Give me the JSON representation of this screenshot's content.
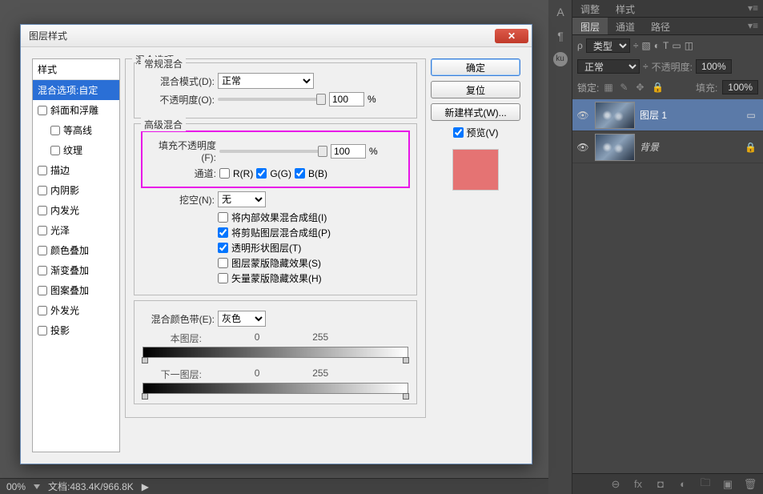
{
  "dialog": {
    "title": "图层样式",
    "styleListHeader": "样式",
    "styles": [
      {
        "label": "混合选项:自定",
        "sel": true,
        "chk": null
      },
      {
        "label": "斜面和浮雕",
        "chk": false
      },
      {
        "label": "等高线",
        "chk": false,
        "indent": true
      },
      {
        "label": "纹理",
        "chk": false,
        "indent": true
      },
      {
        "label": "描边",
        "chk": false
      },
      {
        "label": "内阴影",
        "chk": false
      },
      {
        "label": "内发光",
        "chk": false
      },
      {
        "label": "光泽",
        "chk": false
      },
      {
        "label": "颜色叠加",
        "chk": false
      },
      {
        "label": "渐变叠加",
        "chk": false
      },
      {
        "label": "图案叠加",
        "chk": false
      },
      {
        "label": "外发光",
        "chk": false
      },
      {
        "label": "投影",
        "chk": false
      }
    ],
    "blendOptions": {
      "legend": "混合选项",
      "general": {
        "legend": "常规混合",
        "modeLabel": "混合模式(D):",
        "modeValue": "正常",
        "opacityLabel": "不透明度(O):",
        "opacityValue": "100",
        "pct": "%"
      },
      "advanced": {
        "legend": "高级混合",
        "fillLabel": "填充不透明度(F):",
        "fillValue": "100",
        "pct": "%",
        "channelsLabel": "通道:",
        "chR": "R(R)",
        "chG": "G(G)",
        "chB": "B(B)",
        "knockoutLabel": "挖空(N):",
        "knockoutValue": "无",
        "cbs": [
          {
            "label": "将内部效果混合成组(I)",
            "checked": false
          },
          {
            "label": "将剪贴图层混合成组(P)",
            "checked": true
          },
          {
            "label": "透明形状图层(T)",
            "checked": true
          },
          {
            "label": "图层蒙版隐藏效果(S)",
            "checked": false
          },
          {
            "label": "矢量蒙版隐藏效果(H)",
            "checked": false
          }
        ]
      },
      "blendIf": {
        "label": "混合颜色带(E):",
        "value": "灰色",
        "thisLayer": "本图层:",
        "thisLow": "0",
        "thisHigh": "255",
        "underLayer": "下一图层:",
        "underLow": "0",
        "underHigh": "255"
      }
    },
    "buttons": {
      "ok": "确定",
      "cancel": "复位",
      "newStyle": "新建样式(W)...",
      "preview": "预览(V)"
    }
  },
  "panels": {
    "topTabs": [
      "调整",
      "样式"
    ],
    "layerTabs": [
      "图层",
      "通道",
      "路径"
    ],
    "layerKind": "类型",
    "blendMode": "正常",
    "opacityLabel": "不透明度:",
    "opacityVal": "100%",
    "lockLabel": "锁定:",
    "fillLabel": "填充:",
    "fillVal": "100%",
    "layers": [
      {
        "name": "图层 1",
        "sel": true,
        "locked": false,
        "ital": false
      },
      {
        "name": "背景",
        "sel": false,
        "locked": true,
        "ital": true
      }
    ]
  },
  "statusBar": {
    "zoom": "00%",
    "doc": "文档:483.4K/966.8K"
  }
}
